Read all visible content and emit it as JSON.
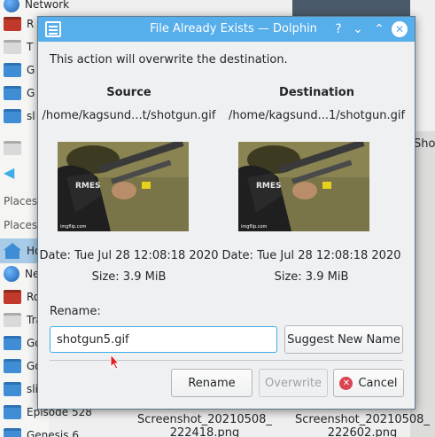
{
  "background": {
    "sidebar_items": [
      {
        "label": "Network",
        "icon": "globe-icon"
      },
      {
        "label": "R",
        "icon": "folder-red-icon"
      },
      {
        "label": "T",
        "icon": "folder-grey-icon"
      },
      {
        "label": "G",
        "icon": "folder-icon"
      },
      {
        "label": "G",
        "icon": "folder-icon"
      },
      {
        "label": "sl",
        "icon": "folder-icon"
      }
    ],
    "places_labels": [
      "Places",
      "Places"
    ],
    "places_items": [
      {
        "label": "Ho",
        "icon": "home-icon"
      },
      {
        "label": "Ne",
        "icon": "globe-icon"
      },
      {
        "label": "Ro",
        "icon": "folder-red-icon"
      },
      {
        "label": "Tra",
        "icon": "folder-grey-icon"
      },
      {
        "label": "Go",
        "icon": "folder-icon"
      },
      {
        "label": "Go",
        "icon": "folder-icon"
      },
      {
        "label": "sli",
        "icon": "folder-icon"
      },
      {
        "label": "Episode 528",
        "icon": "folder-icon"
      },
      {
        "label": "Genesis 6",
        "icon": "folder-icon"
      }
    ],
    "right_label": "Sho",
    "captions": [
      {
        "line1": "Screenshot_20210508_",
        "line2": "222418.png"
      },
      {
        "line1": "Screenshot_20210508_",
        "line2": "222602.png"
      }
    ]
  },
  "dialog": {
    "title": "File Already Exists — Dolphin",
    "titlebar_buttons": {
      "help": "?",
      "minimize": "⌄",
      "maximize": "⌃",
      "close": "✕"
    },
    "message": "This action will overwrite the destination.",
    "source": {
      "heading": "Source",
      "path": "/home/kagsund...t/shotgun.gif",
      "date": "Date: Tue Jul 28 12:08:18 2020",
      "size": "Size: 3.9 MiB"
    },
    "destination": {
      "heading": "Destination",
      "path": "/home/kagsund...1/shotgun.gif",
      "date": "Date: Tue Jul 28 12:08:18 2020",
      "size": "Size: 3.9 MiB"
    },
    "thumbnail_watermark": "imgflip.com",
    "rename_label": "Rename:",
    "rename_value": "shotgun5.gif",
    "buttons": {
      "suggest": "Suggest New Name",
      "rename": "Rename",
      "overwrite": "Overwrite",
      "cancel": "Cancel"
    },
    "colors": {
      "titlebar": "#56aeea",
      "focus": "#3daee9",
      "cancel_icon": "#da4453"
    }
  }
}
